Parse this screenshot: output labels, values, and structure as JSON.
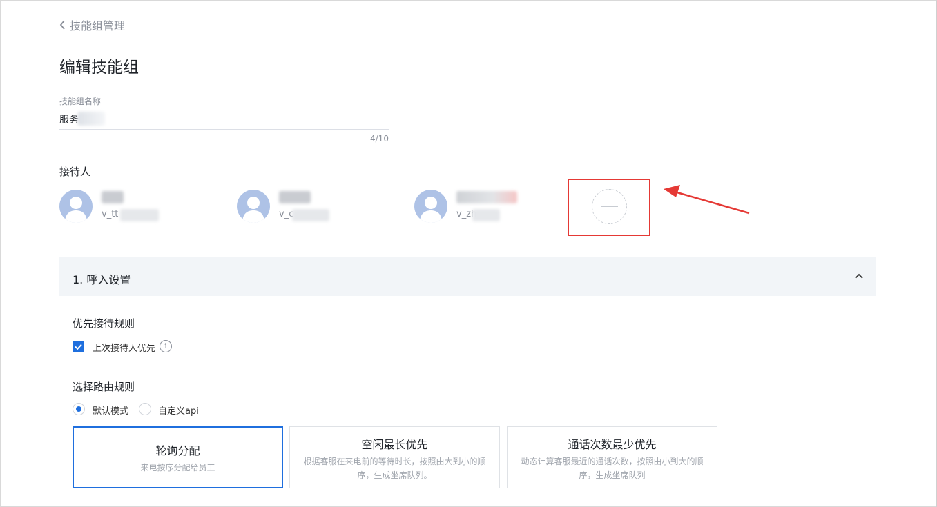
{
  "header": {
    "back_label": "技能组管理",
    "page_title": "编辑技能组"
  },
  "name_field": {
    "label": "技能组名称",
    "value": "服务",
    "counter": "4/10"
  },
  "receivers": {
    "label": "接待人",
    "agents": [
      {
        "id_prefix": "v_tt"
      },
      {
        "id_prefix": "v_c"
      },
      {
        "id_prefix": "v_zh"
      }
    ]
  },
  "section": {
    "title": "1. 呼入设置"
  },
  "priority": {
    "title": "优先接待规则",
    "checkbox_label": "上次接待人优先",
    "checked": true,
    "info_glyph": "i"
  },
  "routing": {
    "title": "选择路由规则",
    "options": [
      {
        "label": "默认模式",
        "selected": true
      },
      {
        "label": "自定义api",
        "selected": false
      }
    ],
    "cards": [
      {
        "title": "轮询分配",
        "desc": "来电按序分配给员工",
        "active": true
      },
      {
        "title": "空闲最长优先",
        "desc": "根据客服在来电前的等待时长，按照由大到小的顺序，生成坐席队列。",
        "active": false
      },
      {
        "title": "通话次数最少优先",
        "desc": "动态计算客服最近的通话次数，按照由小到大的顺序，生成坐席队列",
        "active": false
      }
    ]
  },
  "colors": {
    "accent": "#1f6fde",
    "highlight": "#e53935",
    "avatar": "#aec2e6"
  }
}
